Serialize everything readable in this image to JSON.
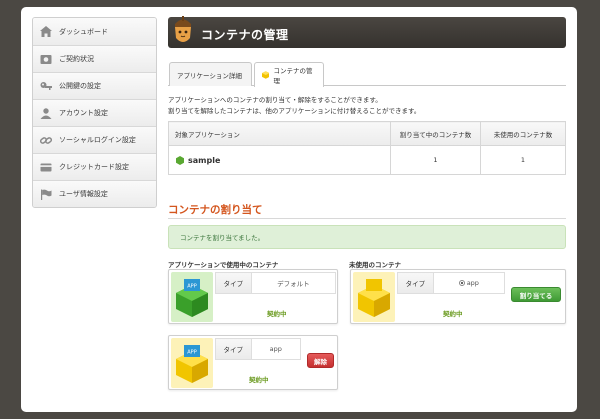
{
  "sidebar": {
    "items": [
      {
        "label": "ダッシュボード",
        "icon": "home-icon"
      },
      {
        "label": "ご契約状況",
        "icon": "contract-icon"
      },
      {
        "label": "公開鍵の設定",
        "icon": "key-icon"
      },
      {
        "label": "アカウント設定",
        "icon": "user-icon"
      },
      {
        "label": "ソーシャルログイン設定",
        "icon": "link-icon"
      },
      {
        "label": "クレジットカード設定",
        "icon": "credit-card-icon"
      },
      {
        "label": "ユーザ情報設定",
        "icon": "flag-icon"
      }
    ]
  },
  "header": {
    "title": "コンテナの管理"
  },
  "tabs": [
    {
      "label": "アプリケーション詳細",
      "active": false
    },
    {
      "label": "コンテナの管理",
      "active": true
    }
  ],
  "description": {
    "line1": "アプリケーションへのコンテナの割り当て・解除をすることができます。",
    "line2": "割り当てを解除したコンテナは、他のアプリケーションに付け替えることができます。"
  },
  "table": {
    "headers": [
      "対象アプリケーション",
      "割り当て中のコンテナ数",
      "未使用のコンテナ数"
    ],
    "row": {
      "app": "sample",
      "assigned": "1",
      "unused": "1"
    }
  },
  "section": {
    "title": "コンテナの割り当て"
  },
  "alert": {
    "message": "コンテナを割り当てました。"
  },
  "in_use": {
    "heading": "アプリケーションで使用中のコンテナ",
    "cards": [
      {
        "type_label": "タイプ",
        "type_value": "デフォルト",
        "status": "契約中",
        "cube_color": "green"
      },
      {
        "type_label": "タイプ",
        "type_value": "app",
        "status": "契約中",
        "cube_color": "yellow",
        "button": "解除"
      }
    ]
  },
  "unused": {
    "heading": "未使用のコンテナ",
    "cards": [
      {
        "type_label": "タイプ",
        "type_value": "app",
        "status": "契約中",
        "cube_color": "yellow",
        "button": "割り当てる"
      }
    ]
  },
  "colors": {
    "accent": "#d4561e",
    "success_bg": "#dff0d8",
    "green_btn": "#4aa83e",
    "red_btn": "#d23c3c"
  }
}
